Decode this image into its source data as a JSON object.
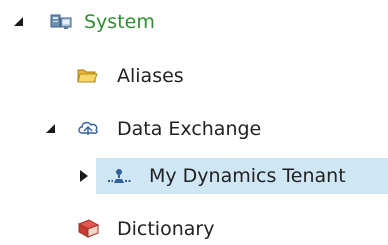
{
  "tree": {
    "system": {
      "label": "System",
      "expanded": true,
      "icon": "system-icon",
      "color": "#2f8f2f"
    },
    "aliases": {
      "label": "Aliases",
      "icon": "folder-icon"
    },
    "data_exchange": {
      "label": "Data Exchange",
      "expanded": true,
      "icon": "cloud-sync-icon"
    },
    "my_dynamics_tenant": {
      "label": "My Dynamics Tenant",
      "expanded": false,
      "selected": true,
      "icon": "tenant-icon"
    },
    "dictionary": {
      "label": "Dictionary",
      "icon": "book-icon"
    }
  },
  "colors": {
    "selection": "#cfe6f5",
    "system_text": "#2f8f2f",
    "text": "#222222"
  }
}
